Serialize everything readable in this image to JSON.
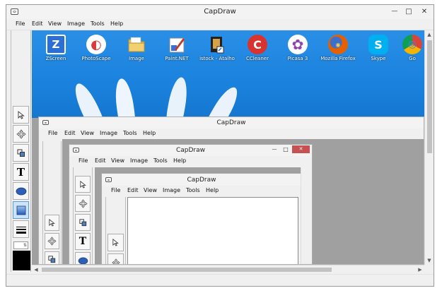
{
  "window_title": "CapDraw",
  "menu": [
    "File",
    "Edit",
    "View",
    "Image",
    "Tools",
    "Help"
  ],
  "window_controls": {
    "minimize": "—",
    "maximize": "□",
    "close": "✕"
  },
  "tools": [
    {
      "name": "select-tool",
      "icon": "arrow-pointer-icon"
    },
    {
      "name": "move-tool",
      "icon": "move-arrows-icon"
    },
    {
      "name": "crop-tool",
      "icon": "crop-icon"
    },
    {
      "name": "text-tool",
      "icon": "text-icon",
      "glyph": "T"
    },
    {
      "name": "ellipse-tool",
      "icon": "ellipse-icon"
    },
    {
      "name": "rectangle-tool",
      "icon": "rectangle-icon"
    },
    {
      "name": "line-width-tool",
      "icon": "line-width-icon"
    }
  ],
  "desktop_icons": [
    {
      "label": "ZScreen",
      "icon": "zscreen-icon",
      "glyph": "Z",
      "color": "#2b6fd6"
    },
    {
      "label": "PhotoScape",
      "icon": "photoscape-icon",
      "glyph": "◐",
      "color": "#d83b3b"
    },
    {
      "label": "Image",
      "icon": "folder-icon",
      "glyph": "",
      "color": "#e8c35a"
    },
    {
      "label": "Paint.NET",
      "icon": "paintnet-icon",
      "glyph": "✎",
      "color": "#c8c8c8"
    },
    {
      "label": "istock - Atalho",
      "icon": "istock-icon",
      "glyph": "",
      "color": "#d6a347"
    },
    {
      "label": "CCleaner",
      "icon": "ccleaner-icon",
      "glyph": "C",
      "color": "#d9332f"
    },
    {
      "label": "Picasa 3",
      "icon": "picasa-icon",
      "glyph": "✿",
      "color": "#8e44ad"
    },
    {
      "label": "Mozilla Firefox",
      "icon": "firefox-icon",
      "glyph": "◉",
      "color": "#e66000"
    },
    {
      "label": "Skype",
      "icon": "skype-icon",
      "glyph": "S",
      "color": "#00aff0"
    },
    {
      "label": "Go",
      "icon": "chrome-icon",
      "glyph": "◎",
      "color": "#4caf50"
    }
  ],
  "colors": {
    "desktop_blue": "#1a86e0",
    "selection_blue": "#cde3f7",
    "window_bg": "#f0f0f0",
    "canvas_gray": "#a0a0a0",
    "close_red": "#c75050"
  }
}
